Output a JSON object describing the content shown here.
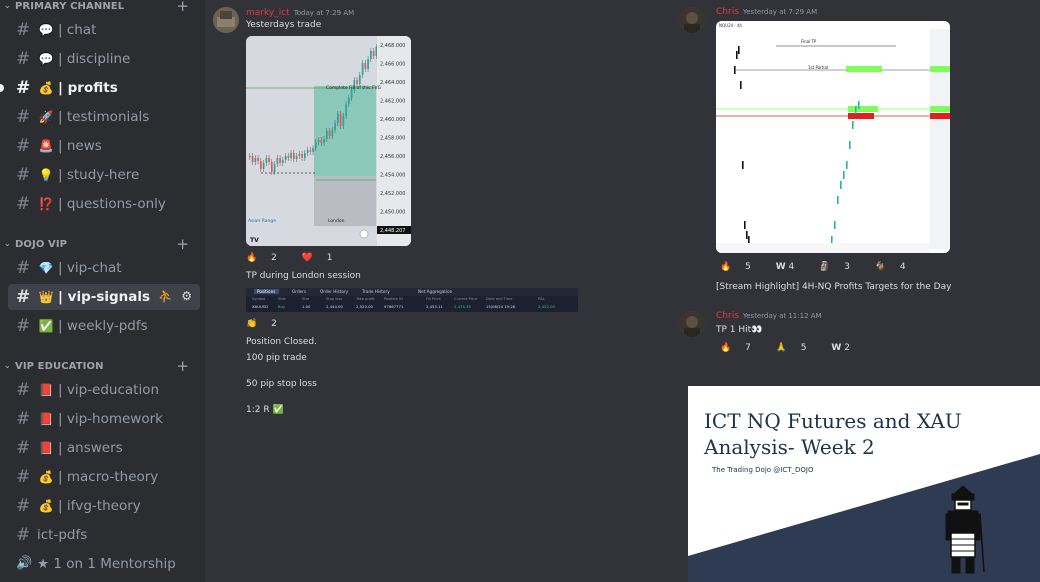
{
  "sidebar": {
    "primary_channel": {
      "label": "PRIMARY CHANNEL",
      "channels": [
        {
          "name": "chat",
          "emoji": "💬"
        },
        {
          "name": "discipline",
          "emoji": "💬"
        },
        {
          "name": "profits",
          "emoji": "💰"
        },
        {
          "name": "testimonials",
          "emoji": "🚀"
        },
        {
          "name": "news",
          "emoji": "🚨"
        },
        {
          "name": "study-here",
          "emoji": "💡"
        },
        {
          "name": "questions-only",
          "emoji": "⁉️"
        }
      ]
    },
    "dojo_vip": {
      "label": "DOJO VIP",
      "channels": [
        {
          "name": "vip-chat",
          "emoji": "💎"
        },
        {
          "name": "vip-signals",
          "emoji": "👑"
        },
        {
          "name": "weekly-pdfs",
          "emoji": "✅"
        }
      ]
    },
    "vip_education": {
      "label": "VIP EDUCATION",
      "channels": [
        {
          "name": "vip-education",
          "emoji": "📕"
        },
        {
          "name": "vip-homework",
          "emoji": "📕"
        },
        {
          "name": "answers",
          "emoji": "📕"
        },
        {
          "name": "macro-theory",
          "emoji": "💰"
        },
        {
          "name": "ifvg-theory",
          "emoji": "💰"
        },
        {
          "name": "ict-pdfs",
          "emoji": ""
        },
        {
          "name": "1 on 1 Mentorship",
          "emoji": ""
        }
      ]
    },
    "separator": "|"
  },
  "left_messages": {
    "m1": {
      "author": "marky_ict",
      "time": "Today at 7:29 AM",
      "text": "Yesterdays trade",
      "chart_prices": [
        "2,468.000",
        "2,466.000",
        "2,464.000",
        "2,462.000",
        "2,460.000",
        "2,458.000",
        "2,456.000",
        "2,454.000",
        "2,452.000",
        "2,450.000",
        "2,448.207"
      ],
      "chart_labels": {
        "fill": "Complete Fill of this FVG",
        "asian": "Asian Range",
        "london": "London",
        "tv": "TV"
      },
      "reactions": [
        {
          "emoji": "🔥",
          "count": "2"
        },
        {
          "emoji": "❤️",
          "count": "1"
        }
      ]
    },
    "m2_text": "TP during London session",
    "positions_table": {
      "tabs": [
        "Positions",
        "Orders",
        "Order History",
        "Trade History",
        "Net Aggregation"
      ],
      "headers": [
        "Symbol",
        "Side",
        "Size",
        "Stop loss",
        "Take profit",
        "Position ID",
        "Fill Price",
        "Current Price",
        "Date and Time",
        "P&L"
      ],
      "row": [
        "XAUUSD",
        "Buy",
        "1.00",
        "2,444.00",
        "2,520.00",
        "97667771",
        "2,455.11",
        "2,475.35",
        "15/08/24 15:26",
        "2,422.00"
      ]
    },
    "m2_reactions": [
      {
        "emoji": "👏",
        "count": "2"
      }
    ],
    "m3_lines": [
      "Position Closed.",
      "100 pip trade",
      "",
      "50 pip stop loss",
      "",
      "1:2 R ✅"
    ]
  },
  "right_messages": {
    "m1": {
      "author": "Chris",
      "time": "Yesterday at 7:29 AM",
      "chart_header": "NQU24 · 4h",
      "chart_labels": {
        "final_tp": "Final TP",
        "partial": "1st Partial"
      },
      "reactions": [
        {
          "emoji": "🔥",
          "count": "5"
        },
        {
          "emoji": "W",
          "count": "4"
        },
        {
          "emoji": "🗿",
          "count": "3"
        },
        {
          "emoji": "🐐",
          "count": "4"
        }
      ],
      "text": "[Stream Highlight] 4H-NQ Profits Targets for the Day"
    },
    "m2": {
      "author": "Chris",
      "time": "Yesterday at 11:12 AM",
      "text": "TP 1 Hit👀",
      "reactions": [
        {
          "emoji": "🔥",
          "count": "7"
        },
        {
          "emoji": "🙏",
          "count": "5"
        },
        {
          "emoji": "W",
          "count": "2"
        }
      ]
    }
  },
  "embed": {
    "title": "ICT NQ Futures and XAU Analysis- Week 2",
    "subtitle": "The Trading Dojo @ICT_DOJO"
  }
}
